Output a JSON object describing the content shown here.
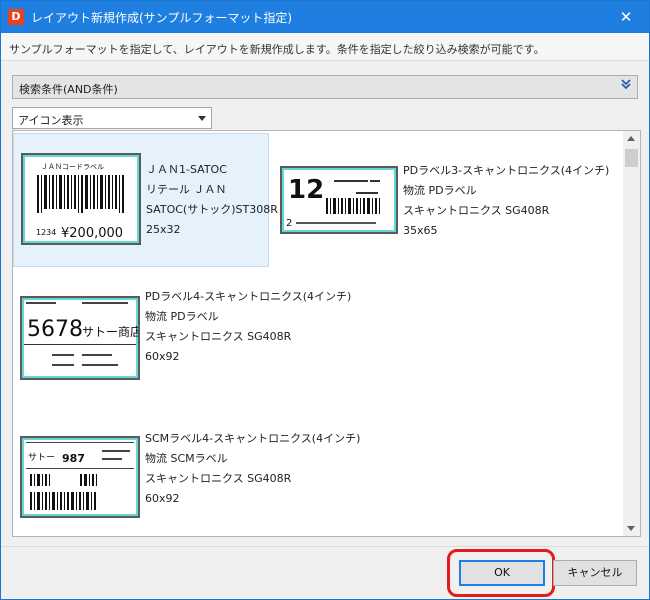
{
  "window": {
    "app_icon_letter": "D",
    "title": "レイアウト新規作成(サンプルフォーマット指定)",
    "close_glyph": "✕"
  },
  "description": "サンプルフォーマットを指定して、レイアウトを新規作成します。条件を指定した絞り込み検索が可能です。",
  "search": {
    "label": "検索条件(AND条件)",
    "expand_icon": "double-chevron-down-icon"
  },
  "view_mode": {
    "selected": "アイコン表示"
  },
  "formats": [
    {
      "name": "ＪＡＮ1-SATOC",
      "category": "リテール ＪＡＮ",
      "printer": "SATOC(サトック)ST308R",
      "size": "25x32",
      "selected": true,
      "thumb_text": {
        "header": "ＪＡＮコードラベル",
        "code": "1234",
        "price": "¥200,000"
      }
    },
    {
      "name": "PDラベル3-スキャントロニクス(4インチ)",
      "category": "物流 PDラベル",
      "printer": "スキャントロニクス SG408R",
      "size": "35x65",
      "selected": false,
      "thumb_text": {
        "big": "12",
        "small": "2"
      }
    },
    {
      "name": "PDラベル4-スキャントロニクス(4インチ)",
      "category": "物流 PDラベル",
      "printer": "スキャントロニクス SG408R",
      "size": "60x92",
      "selected": false,
      "thumb_text": {
        "big": "5678",
        "shop": "サトー商店"
      }
    },
    {
      "name": "SCMラベル4-スキャントロニクス(4インチ)",
      "category": "物流 SCMラベル",
      "printer": "スキャントロニクス SG408R",
      "size": "60x92",
      "selected": false,
      "thumb_text": {
        "company": "サトー",
        "number": "987"
      }
    }
  ],
  "buttons": {
    "ok": "OK",
    "cancel": "キャンセル"
  },
  "colors": {
    "titlebar": "#1e7fe0",
    "selection": "#e5f1fb",
    "highlight": "#e41b1b",
    "thumb_border": "#63d6d6"
  }
}
